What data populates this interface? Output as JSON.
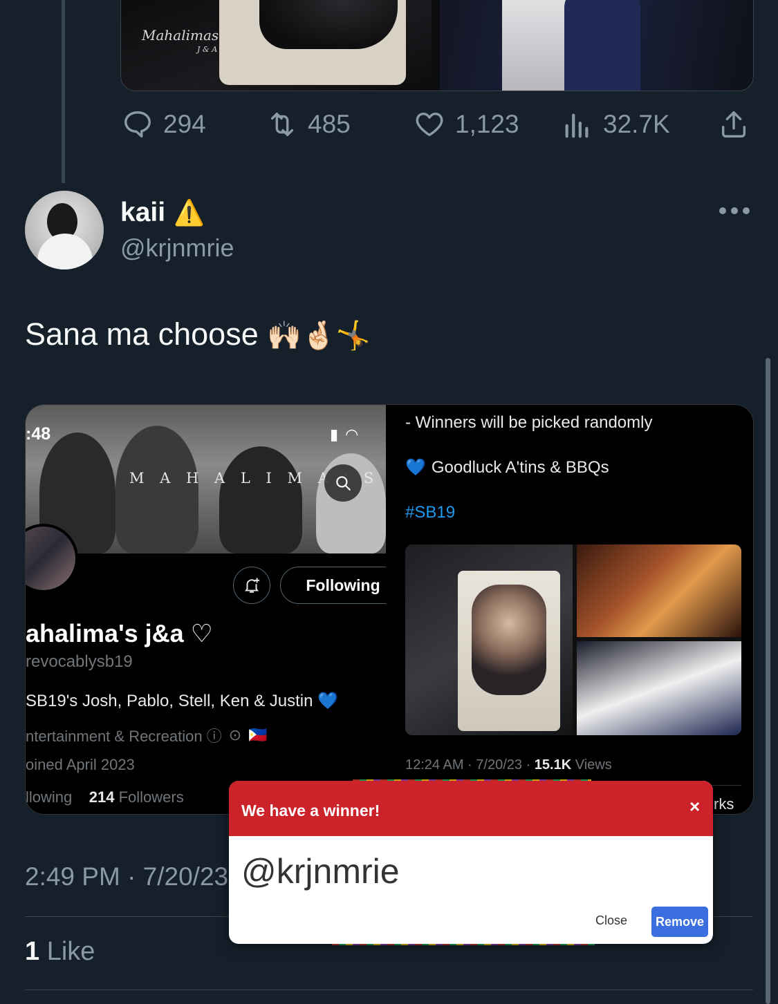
{
  "prev_tweet": {
    "watermark": "Mahalimas",
    "watermark_sub": "J & A",
    "actions": {
      "replies": "294",
      "retweets": "485",
      "likes": "1,123",
      "views": "32.7K"
    }
  },
  "tweet": {
    "author_name": "kaii",
    "author_badge": "⚠️",
    "author_handle": "@krjnmrie",
    "text": "Sana ma choose",
    "emojis": "🙌🏻🤞🏻🤸",
    "timestamp": "2:49 PM · 7/20/23",
    "likes_count": "1",
    "likes_label": "Like"
  },
  "embedded_profile": {
    "status_time": ":48",
    "banner_text": "M A H A L I M A ' S",
    "following_label": "Following",
    "name": "ahalima's j&a ♡",
    "handle": "revocablysb19",
    "bio": "SB19's Josh, Pablo, Stell, Ken & Justin 💙",
    "category": "ntertainment & Recreation ⓘ",
    "flag": "🇵🇭",
    "joined": "oined April 2023",
    "following_tail": "llowing",
    "followers_count": "214",
    "followers_label": "Followers"
  },
  "embedded_tweet": {
    "line1": "- Winners will be picked randomly",
    "heart": "💙",
    "line2": "Goodluck A'tins & BBQs",
    "hashtag": "#SB19",
    "time": "12:24 AM · 7/20/23 · ",
    "views_count": "15.1K",
    "views_label": "Views",
    "tail": "rks"
  },
  "modal": {
    "title": "We have a winner!",
    "close_x": "×",
    "winner": "@krjnmrie",
    "close_label": "Close",
    "remove_label": "Remove"
  },
  "colors": {
    "background": "#15202b",
    "muted": "#8b98a5",
    "link": "#1d9bf0",
    "modal_header": "#cc2229",
    "remove_button": "#3b6fe0"
  }
}
